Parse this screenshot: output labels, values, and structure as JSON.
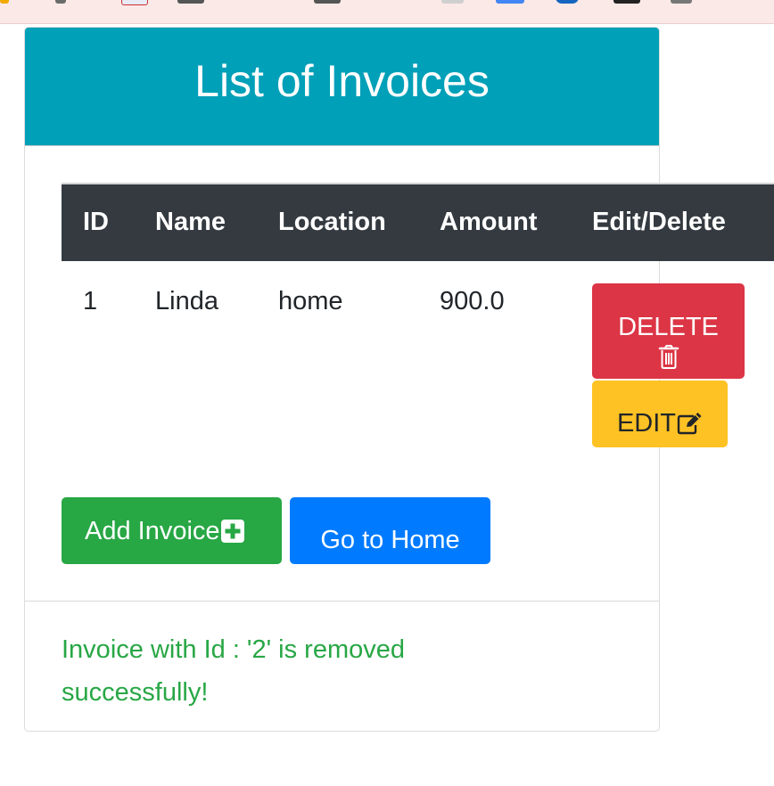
{
  "header": {
    "title": "List of Invoices"
  },
  "table": {
    "columns": [
      "ID",
      "Name",
      "Location",
      "Amount",
      "Edit/Delete"
    ],
    "rows": [
      {
        "id": "1",
        "name": "Linda",
        "location": "home",
        "amount": "900.0"
      }
    ]
  },
  "actions": {
    "delete_label": "DELETE",
    "delete_icon": "trash-icon",
    "edit_label": "EDIT",
    "edit_icon": "edit-icon",
    "add_label": "Add Invoice",
    "add_icon": "plus-square-icon",
    "home_label": "Go to Home"
  },
  "footer": {
    "message": "Invoice with Id : '2' is removed successfully!"
  },
  "colors": {
    "header_bg": "#00a0b8",
    "table_head_bg": "#343a40",
    "delete": "#dc3545",
    "edit": "#ffc224",
    "add": "#28a745",
    "home": "#007bff",
    "success_text": "#28a745"
  }
}
